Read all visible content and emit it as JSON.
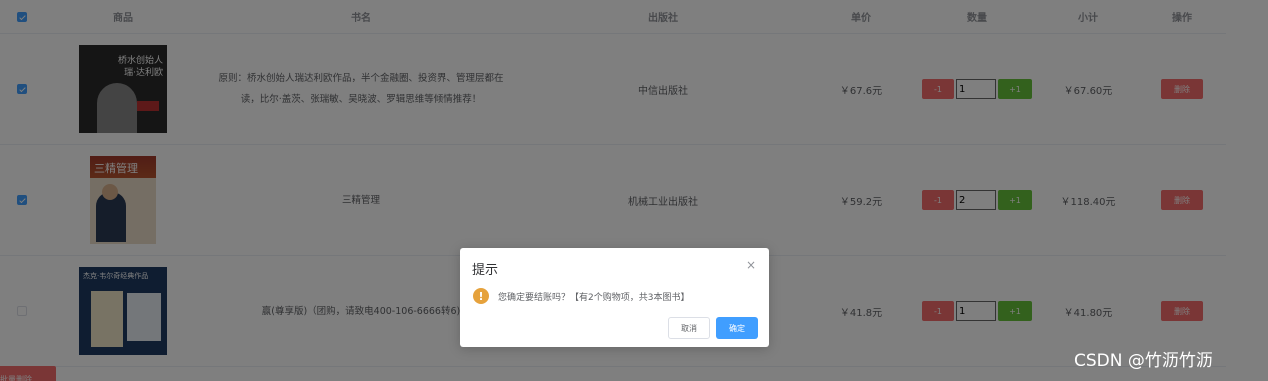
{
  "header": {
    "goods": "商品",
    "name": "书名",
    "publisher": "出版社",
    "price": "单价",
    "quantity": "数量",
    "subtotal": "小计",
    "action": "操作"
  },
  "rows": [
    {
      "checked": true,
      "cover_text": [
        "桥水创始人",
        "瑞·达利欧"
      ],
      "name": "原则：桥水创始人瑞达利欧作品，半个金融圈、投资界、管理层都在读，比尔·盖茨、张瑞敏、吴晓波、罗辑思维等倾情推荐！",
      "publisher": "中信出版社",
      "price": "￥67.6元",
      "qty": "1",
      "subtotal": "￥67.60元"
    },
    {
      "checked": true,
      "cover_text": [
        "三精管理"
      ],
      "name": "三精管理",
      "publisher": "机械工业出版社",
      "price": "￥59.2元",
      "qty": "2",
      "subtotal": "￥118.40元"
    },
    {
      "checked": false,
      "cover_text": [
        "杰克·韦尔奇经典作品"
      ],
      "name": "赢(尊享版)（团购，请致电400-106-6666转6)",
      "publisher": "",
      "price": "￥41.8元",
      "qty": "1",
      "subtotal": "￥41.80元"
    }
  ],
  "buttons": {
    "minus": "-1",
    "plus": "+1",
    "delete": "删除",
    "batch_delete": "批量删除"
  },
  "dialog": {
    "title": "提示",
    "close": "×",
    "icon": "!",
    "message": "您确定要结账吗？【有2个购物项，共3本图书】",
    "cancel": "取消",
    "confirm": "确定"
  },
  "watermark": "CSDN @竹沥竹沥",
  "colors": {
    "primary": "#409eff",
    "danger": "#f56c6c",
    "success": "#67c23a",
    "warning": "#e6a23c"
  }
}
